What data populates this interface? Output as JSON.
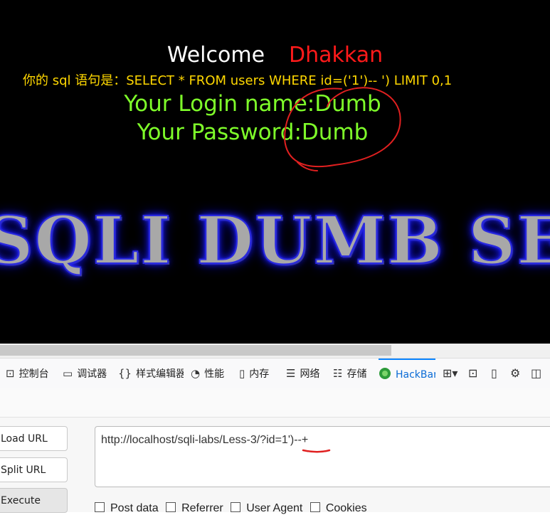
{
  "page": {
    "welcome_label": "Welcome",
    "welcome_name": "Dhakkan",
    "sql_line": "你的 sql 语句是：SELECT * FROM users WHERE id=('1')-- ') LIMIT 0,1",
    "login_name": "Your Login name:Dumb",
    "password": "Your Password:Dumb",
    "banner": "SQLI DUMB SERIES"
  },
  "devtools": {
    "tabs": [
      {
        "label": "控制台",
        "icon": "console-icon"
      },
      {
        "label": "调试器",
        "icon": "debugger-icon"
      },
      {
        "label": "样式编辑器",
        "icon": "style-editor-icon"
      },
      {
        "label": "性能",
        "icon": "performance-icon"
      },
      {
        "label": "内存",
        "icon": "memory-icon"
      },
      {
        "label": "网络",
        "icon": "network-icon"
      },
      {
        "label": "存储",
        "icon": "storage-icon"
      },
      {
        "label": "HackBar",
        "icon": "hackbar-icon"
      }
    ]
  },
  "hackbar": {
    "load_url": "Load URL",
    "split_url": "Split URL",
    "execute": "Execute",
    "url_value": "http://localhost/sqli-labs/Less-3/?id=1')--+",
    "checks": [
      "Post data",
      "Referrer",
      "User Agent",
      "Cookies"
    ]
  },
  "colors": {
    "background": "#000000",
    "welcome": "#ffffff",
    "name": "#ff1a1a",
    "sql": "#ffd700",
    "login": "#7fff2a",
    "annotation": "#e02020",
    "active_tab": "#0a84ff"
  }
}
